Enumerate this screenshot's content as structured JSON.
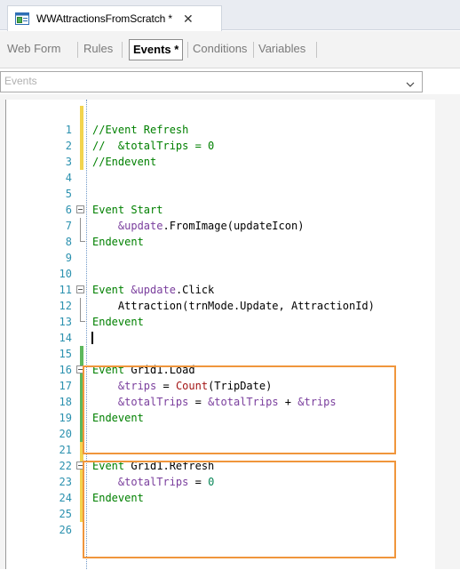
{
  "document": {
    "tab_title": "WWAttractionsFromScratch *",
    "close_glyph": "✕",
    "icon": "web-panel-icon"
  },
  "toolbar": {
    "tabs": [
      {
        "label": "Web Form",
        "active": false
      },
      {
        "label": "Rules",
        "active": false
      },
      {
        "label": "Events *",
        "active": true
      },
      {
        "label": "Conditions",
        "active": false
      },
      {
        "label": "Variables",
        "active": false
      }
    ]
  },
  "dropdown": {
    "value": "Events",
    "icon": "chevron-down-icon"
  },
  "colors": {
    "keyword": "#008000",
    "variable": "#7a3e9d",
    "function": "#a31515",
    "line_number": "#2b91af",
    "change_saved": "#5cb85c",
    "change_unsaved": "#f2d44e",
    "highlight_box": "#f0963c"
  },
  "code": {
    "lines": [
      {
        "n": "1",
        "text": ""
      },
      {
        "n": "2",
        "text": "//Event Refresh"
      },
      {
        "n": "3",
        "text": "//  &totalTrips = 0"
      },
      {
        "n": "4",
        "text": "//Endevent"
      },
      {
        "n": "5",
        "text": ""
      },
      {
        "n": "6",
        "text": ""
      },
      {
        "n": "7",
        "text": "Event Start"
      },
      {
        "n": "8",
        "text": "    &update.FromImage(updateIcon)"
      },
      {
        "n": "9",
        "text": "Endevent"
      },
      {
        "n": "10",
        "text": ""
      },
      {
        "n": "11",
        "text": ""
      },
      {
        "n": "12",
        "text": "Event &update.Click"
      },
      {
        "n": "13",
        "text": "    Attraction(trnMode.Update, AttractionId)"
      },
      {
        "n": "14",
        "text": "Endevent"
      },
      {
        "n": "15",
        "text": ""
      },
      {
        "n": "16",
        "text": ""
      },
      {
        "n": "17",
        "text": "Event Grid1.Load"
      },
      {
        "n": "18",
        "text": "    &trips = Count(TripDate)"
      },
      {
        "n": "19",
        "text": "    &totalTrips = &totalTrips + &trips"
      },
      {
        "n": "20",
        "text": "Endevent"
      },
      {
        "n": "21",
        "text": ""
      },
      {
        "n": "22",
        "text": ""
      },
      {
        "n": "23",
        "text": "Event Grid1.Refresh"
      },
      {
        "n": "24",
        "text": "    &totalTrips = 0"
      },
      {
        "n": "25",
        "text": "Endevent"
      },
      {
        "n": "26",
        "text": ""
      }
    ]
  }
}
